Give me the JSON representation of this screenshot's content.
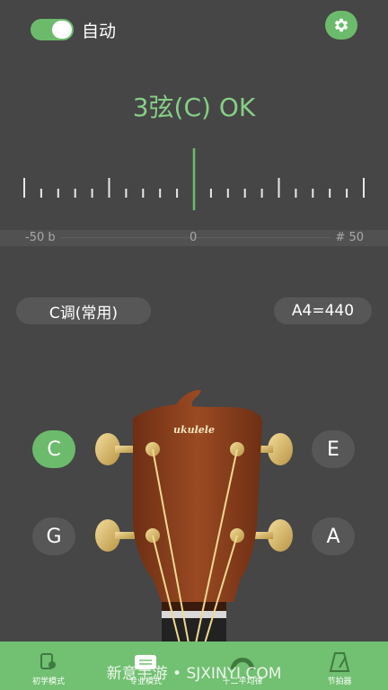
{
  "header": {
    "auto_label": "自动",
    "auto_toggle_on": true
  },
  "tuner": {
    "status": "3弦(C) OK",
    "scale_left": "-50 b",
    "scale_center": "0",
    "scale_right": "# 50"
  },
  "options": {
    "tuning": "C调(常用)",
    "reference": "A4=440"
  },
  "instrument": {
    "brand": "ukulele",
    "strings": {
      "top_left": "C",
      "top_right": "E",
      "bottom_left": "G",
      "bottom_right": "A"
    },
    "selected_string": "C"
  },
  "nav": {
    "items": [
      {
        "label": "初学模式"
      },
      {
        "label": "专业模式"
      },
      {
        "label": "十二平均律"
      },
      {
        "label": "节拍器"
      }
    ]
  },
  "watermark": "新意手游 • SJXINYI.COM",
  "colors": {
    "background": "#464646",
    "accent": "#6cbb6c",
    "status_text": "#86cf86",
    "nav_bar": "#72c072"
  }
}
